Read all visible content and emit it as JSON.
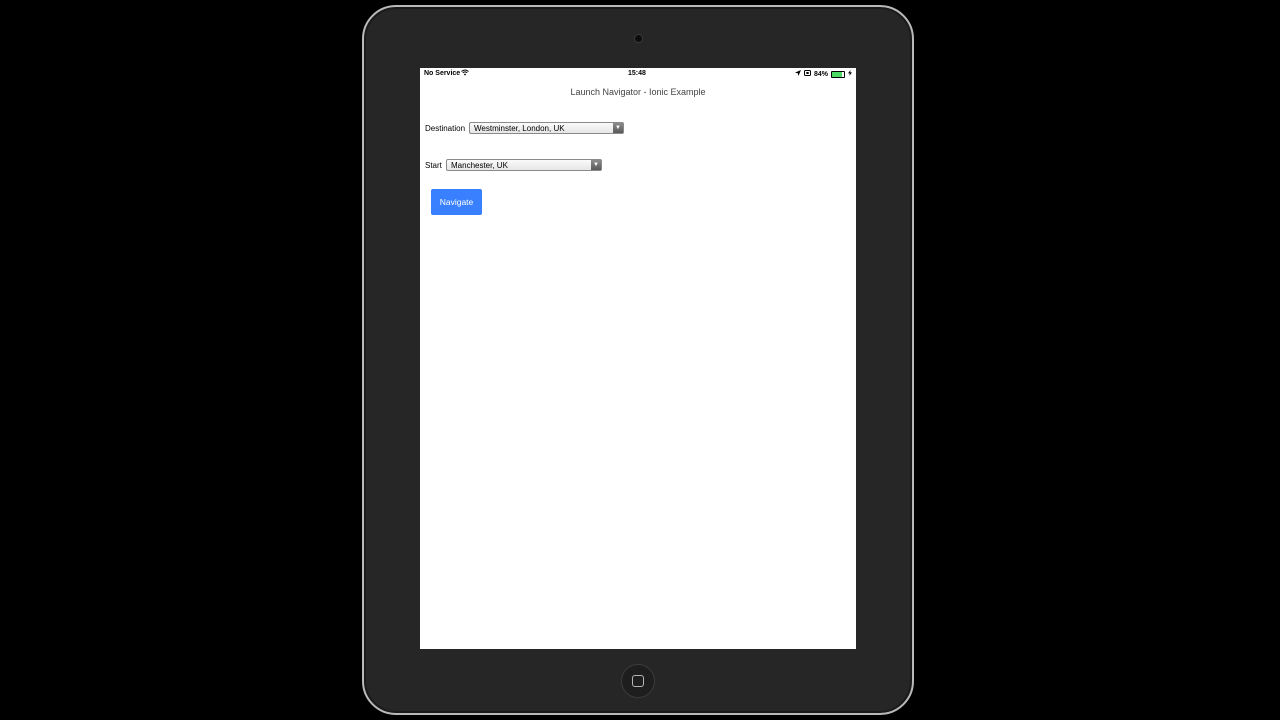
{
  "status_bar": {
    "carrier": "No Service",
    "wifi_icon": "wifi-icon",
    "time": "15:48",
    "location_icon": "location-arrow-icon",
    "orientation_lock_icon": "orientation-lock-icon",
    "battery_percent_text": "84%",
    "battery_level": 0.84,
    "battery_color": "#4cd964",
    "charging_icon": "charging-bolt-icon"
  },
  "page": {
    "title": "Launch Navigator - Ionic Example"
  },
  "form": {
    "destination_label": "Destination",
    "destination_value": "Westminster, London, UK",
    "start_label": "Start",
    "start_value": "Manchester, UK",
    "navigate_label": "Navigate",
    "accent_color": "#3880ff"
  }
}
